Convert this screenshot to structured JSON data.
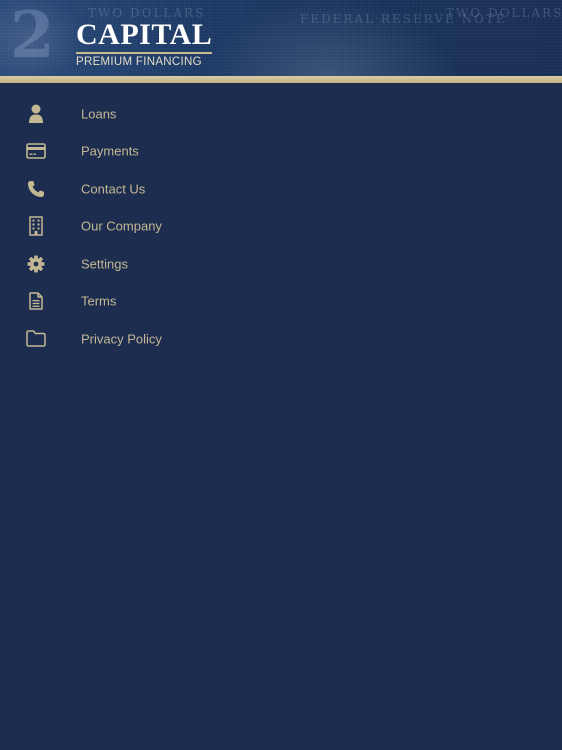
{
  "header": {
    "logo_title": "CAPITAL",
    "logo_subtitle": "PREMIUM FINANCING",
    "bill_text_left": "TWO DOLLARS",
    "bill_text_center": "FEDERAL RESERVE NOTE",
    "bill_text_right": "TWO DOLLARS",
    "bill_numeral": "2"
  },
  "colors": {
    "background": "#1c2d4f",
    "accent_gold": "#c4b894",
    "stripe": "#c9b98a"
  },
  "menu": {
    "items": [
      {
        "label": "Loans",
        "icon": "person-icon"
      },
      {
        "label": "Payments",
        "icon": "credit-card-icon"
      },
      {
        "label": "Contact Us",
        "icon": "phone-icon"
      },
      {
        "label": "Our Company",
        "icon": "building-icon"
      },
      {
        "label": "Settings",
        "icon": "gear-icon"
      },
      {
        "label": "Terms",
        "icon": "document-icon"
      },
      {
        "label": "Privacy Policy",
        "icon": "folder-icon"
      }
    ]
  }
}
